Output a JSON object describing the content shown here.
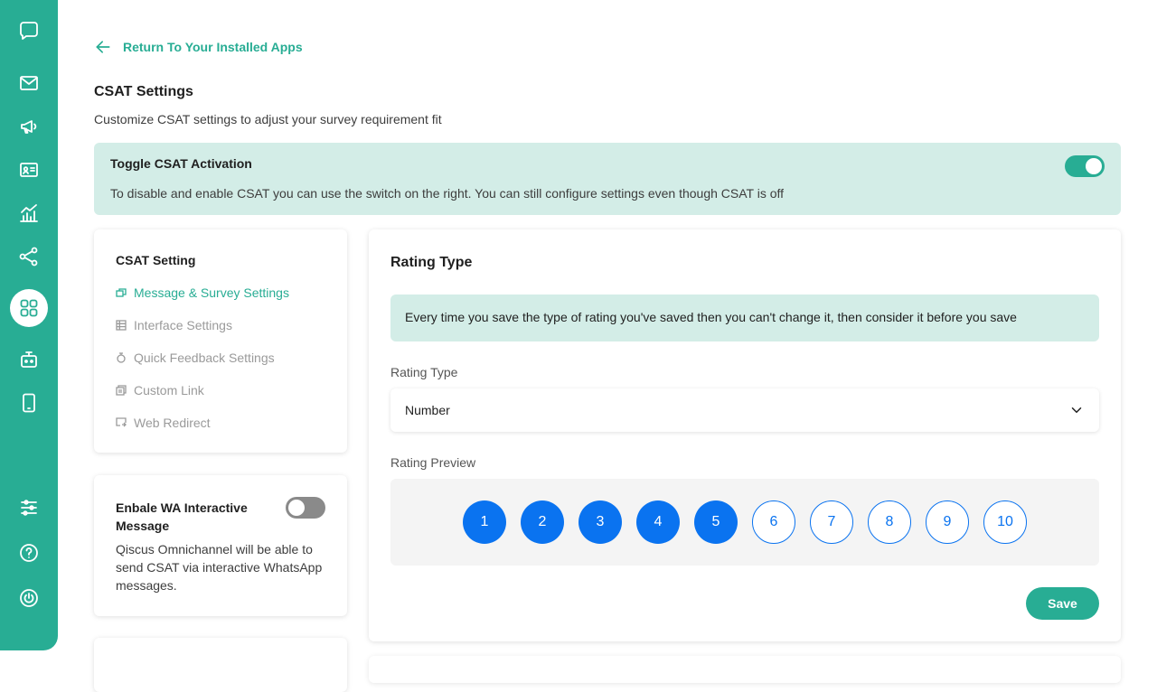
{
  "sidebar": {
    "accent": "#28ad94",
    "icons": [
      "chat-logo-icon",
      "mail-icon",
      "megaphone-icon",
      "contact-card-icon",
      "analytics-icon",
      "share-icon",
      "apps-grid-icon",
      "bot-icon",
      "mobile-icon",
      "settings-sliders-icon",
      "help-icon",
      "power-icon"
    ]
  },
  "back_link": {
    "label": "Return To Your Installed Apps"
  },
  "page": {
    "title": "CSAT Settings",
    "subtitle": "Customize CSAT settings to adjust your survey requirement fit"
  },
  "activation": {
    "title": "Toggle CSAT Activation",
    "description": "To disable and enable CSAT you can use the switch on the right. You can still configure settings even though CSAT is off",
    "enabled": true
  },
  "settings_menu": {
    "title": "CSAT Setting",
    "items": [
      {
        "label": "Message & Survey Settings",
        "active": true
      },
      {
        "label": "Interface Settings",
        "active": false
      },
      {
        "label": "Quick Feedback Settings",
        "active": false
      },
      {
        "label": "Custom Link",
        "active": false
      },
      {
        "label": "Web Redirect",
        "active": false
      }
    ]
  },
  "wa_interactive": {
    "title": "Enbale WA Interactive Message",
    "description": "Qiscus Omnichannel will be able to send CSAT via interactive WhatsApp messages.",
    "enabled": false
  },
  "rating": {
    "title": "Rating Type",
    "notice": "Every time you save the type of rating you've saved then you can't change it, then consider it before you save",
    "type_label": "Rating Type",
    "type_value": "Number",
    "preview_label": "Rating Preview",
    "scale": [
      "1",
      "2",
      "3",
      "4",
      "5",
      "6",
      "7",
      "8",
      "9",
      "10"
    ],
    "filled_count": 5,
    "preview_color": "#0a73f0",
    "save_label": "Save"
  }
}
